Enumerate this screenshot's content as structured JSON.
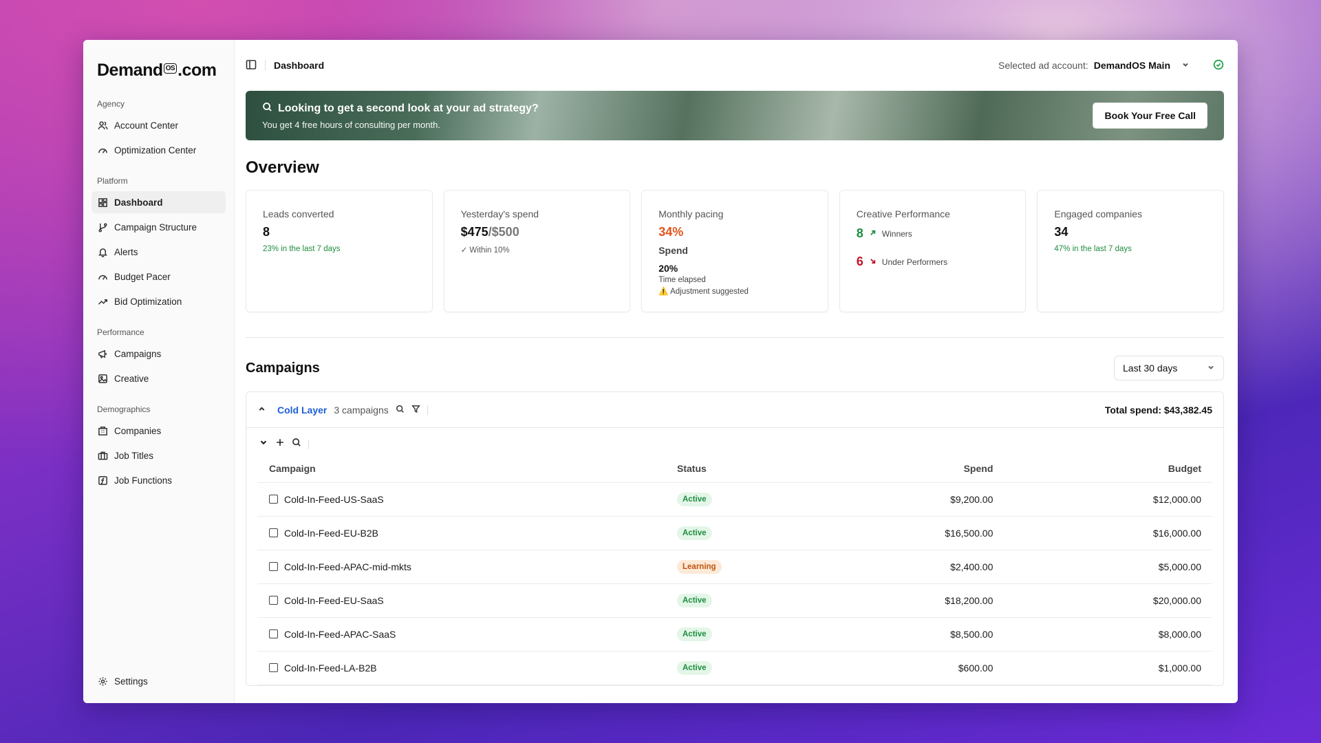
{
  "brand": {
    "logo_pre": "Demand",
    "logo_os": "OS",
    "logo_post": ".com"
  },
  "sidebar": {
    "groups": [
      {
        "title": "Agency",
        "items": [
          {
            "label": "Account Center",
            "icon": "users-icon"
          },
          {
            "label": "Optimization Center",
            "icon": "gauge-icon"
          }
        ]
      },
      {
        "title": "Platform",
        "items": [
          {
            "label": "Dashboard",
            "icon": "dashboard-icon",
            "active": true
          },
          {
            "label": "Campaign Structure",
            "icon": "branch-icon"
          },
          {
            "label": "Alerts",
            "icon": "bell-icon"
          },
          {
            "label": "Budget Pacer",
            "icon": "gauge-icon"
          },
          {
            "label": "Bid Optimization",
            "icon": "trend-up-icon"
          }
        ]
      },
      {
        "title": "Performance",
        "items": [
          {
            "label": "Campaigns",
            "icon": "megaphone-icon"
          },
          {
            "label": "Creative",
            "icon": "image-icon"
          }
        ]
      },
      {
        "title": "Demographics",
        "items": [
          {
            "label": "Companies",
            "icon": "building-icon"
          },
          {
            "label": "Job Titles",
            "icon": "briefcase-icon"
          },
          {
            "label": "Job Functions",
            "icon": "function-icon"
          }
        ]
      }
    ],
    "settings_label": "Settings"
  },
  "header": {
    "title": "Dashboard",
    "account_label": "Selected ad account:",
    "account_value": "DemandOS Main"
  },
  "banner": {
    "title": "Looking to get a second look at your ad strategy?",
    "subtitle": "You get 4 free hours of consulting per month.",
    "button": "Book Your Free Call"
  },
  "overview": {
    "title": "Overview",
    "leads": {
      "label": "Leads converted",
      "value": "8",
      "note": "23% in the last 7 days"
    },
    "spend": {
      "label": "Yesterday's spend",
      "value": "$475",
      "slash": "/",
      "budget": "$500",
      "note": "✓ Within 10%"
    },
    "pacing": {
      "label": "Monthly pacing",
      "value": "34%",
      "spend_label": "Spend",
      "elapsed_value": "20%",
      "elapsed_label": "Time elapsed",
      "warning": "⚠️ Adjustment suggested"
    },
    "creative": {
      "label": "Creative Performance",
      "winners_value": "8",
      "winners_label": "Winners",
      "under_value": "6",
      "under_label": "Under Performers"
    },
    "companies": {
      "label": "Engaged companies",
      "value": "34",
      "note": "47% in the last 7 days"
    }
  },
  "campaigns": {
    "title": "Campaigns",
    "range": "Last 30 days",
    "layer_name": "Cold Layer",
    "layer_count": "3 campaigns",
    "total": "Total spend: $43,382.45",
    "columns": {
      "campaign": "Campaign",
      "status": "Status",
      "spend": "Spend",
      "budget": "Budget"
    },
    "rows": [
      {
        "name": "Cold-In-Feed-US-SaaS",
        "status": "Active",
        "spend": "$9,200.00",
        "budget": "$12,000.00"
      },
      {
        "name": "Cold-In-Feed-EU-B2B",
        "status": "Active",
        "spend": "$16,500.00",
        "budget": "$16,000.00"
      },
      {
        "name": "Cold-In-Feed-APAC-mid-mkts",
        "status": "Learning",
        "spend": "$2,400.00",
        "budget": "$5,000.00"
      },
      {
        "name": "Cold-In-Feed-EU-SaaS",
        "status": "Active",
        "spend": "$18,200.00",
        "budget": "$20,000.00"
      },
      {
        "name": "Cold-In-Feed-APAC-SaaS",
        "status": "Active",
        "spend": "$8,500.00",
        "budget": "$8,000.00"
      },
      {
        "name": "Cold-In-Feed-LA-B2B",
        "status": "Active",
        "spend": "$600.00",
        "budget": "$1,000.00"
      }
    ]
  },
  "colors": {
    "accent_blue": "#1d5fd6",
    "positive": "#1e8c3e",
    "warning": "#e4531b",
    "negative": "#c0162a"
  }
}
